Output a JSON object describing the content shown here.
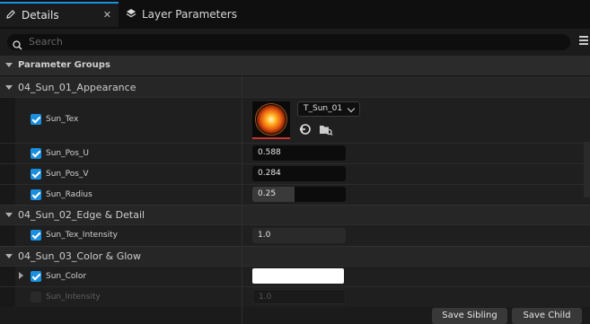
{
  "tabs": [
    {
      "label": "Details",
      "close": "✕"
    },
    {
      "label": "Layer Parameters"
    }
  ],
  "search": {
    "placeholder": "Search"
  },
  "parameter_groups": {
    "title": "Parameter Groups"
  },
  "groups": [
    {
      "name": "04_Sun_01_Appearance"
    },
    {
      "name": "04_Sun_02_Edge & Detail"
    },
    {
      "name": "04_Sun_03_Color & Glow"
    }
  ],
  "params": {
    "sun_tex": {
      "label": "Sun_Tex",
      "asset": "T_Sun_01",
      "enabled": true
    },
    "sun_pos_u": {
      "label": "Sun_Pos_U",
      "value": "0.588",
      "enabled": true
    },
    "sun_pos_v": {
      "label": "Sun_Pos_V",
      "value": "0.284",
      "enabled": true
    },
    "sun_radius": {
      "label": "Sun_Radius",
      "value": "0.25",
      "slider_fraction": 0.45,
      "enabled": true
    },
    "sun_tex_intensity": {
      "label": "Sun_Tex_Intensity",
      "value": "1.0",
      "enabled": true
    },
    "sun_color": {
      "label": "Sun_Color",
      "color": "#ffffff",
      "enabled": true
    },
    "sun_intensity": {
      "label": "Sun_Intensity",
      "value": "1.0",
      "enabled": false
    }
  },
  "buttons": {
    "save_sibling": "Save Sibling",
    "save_child": "Save Child"
  },
  "colors": {
    "accent": "#1a8fe0",
    "thumbnail_underline": "#c8342e"
  }
}
